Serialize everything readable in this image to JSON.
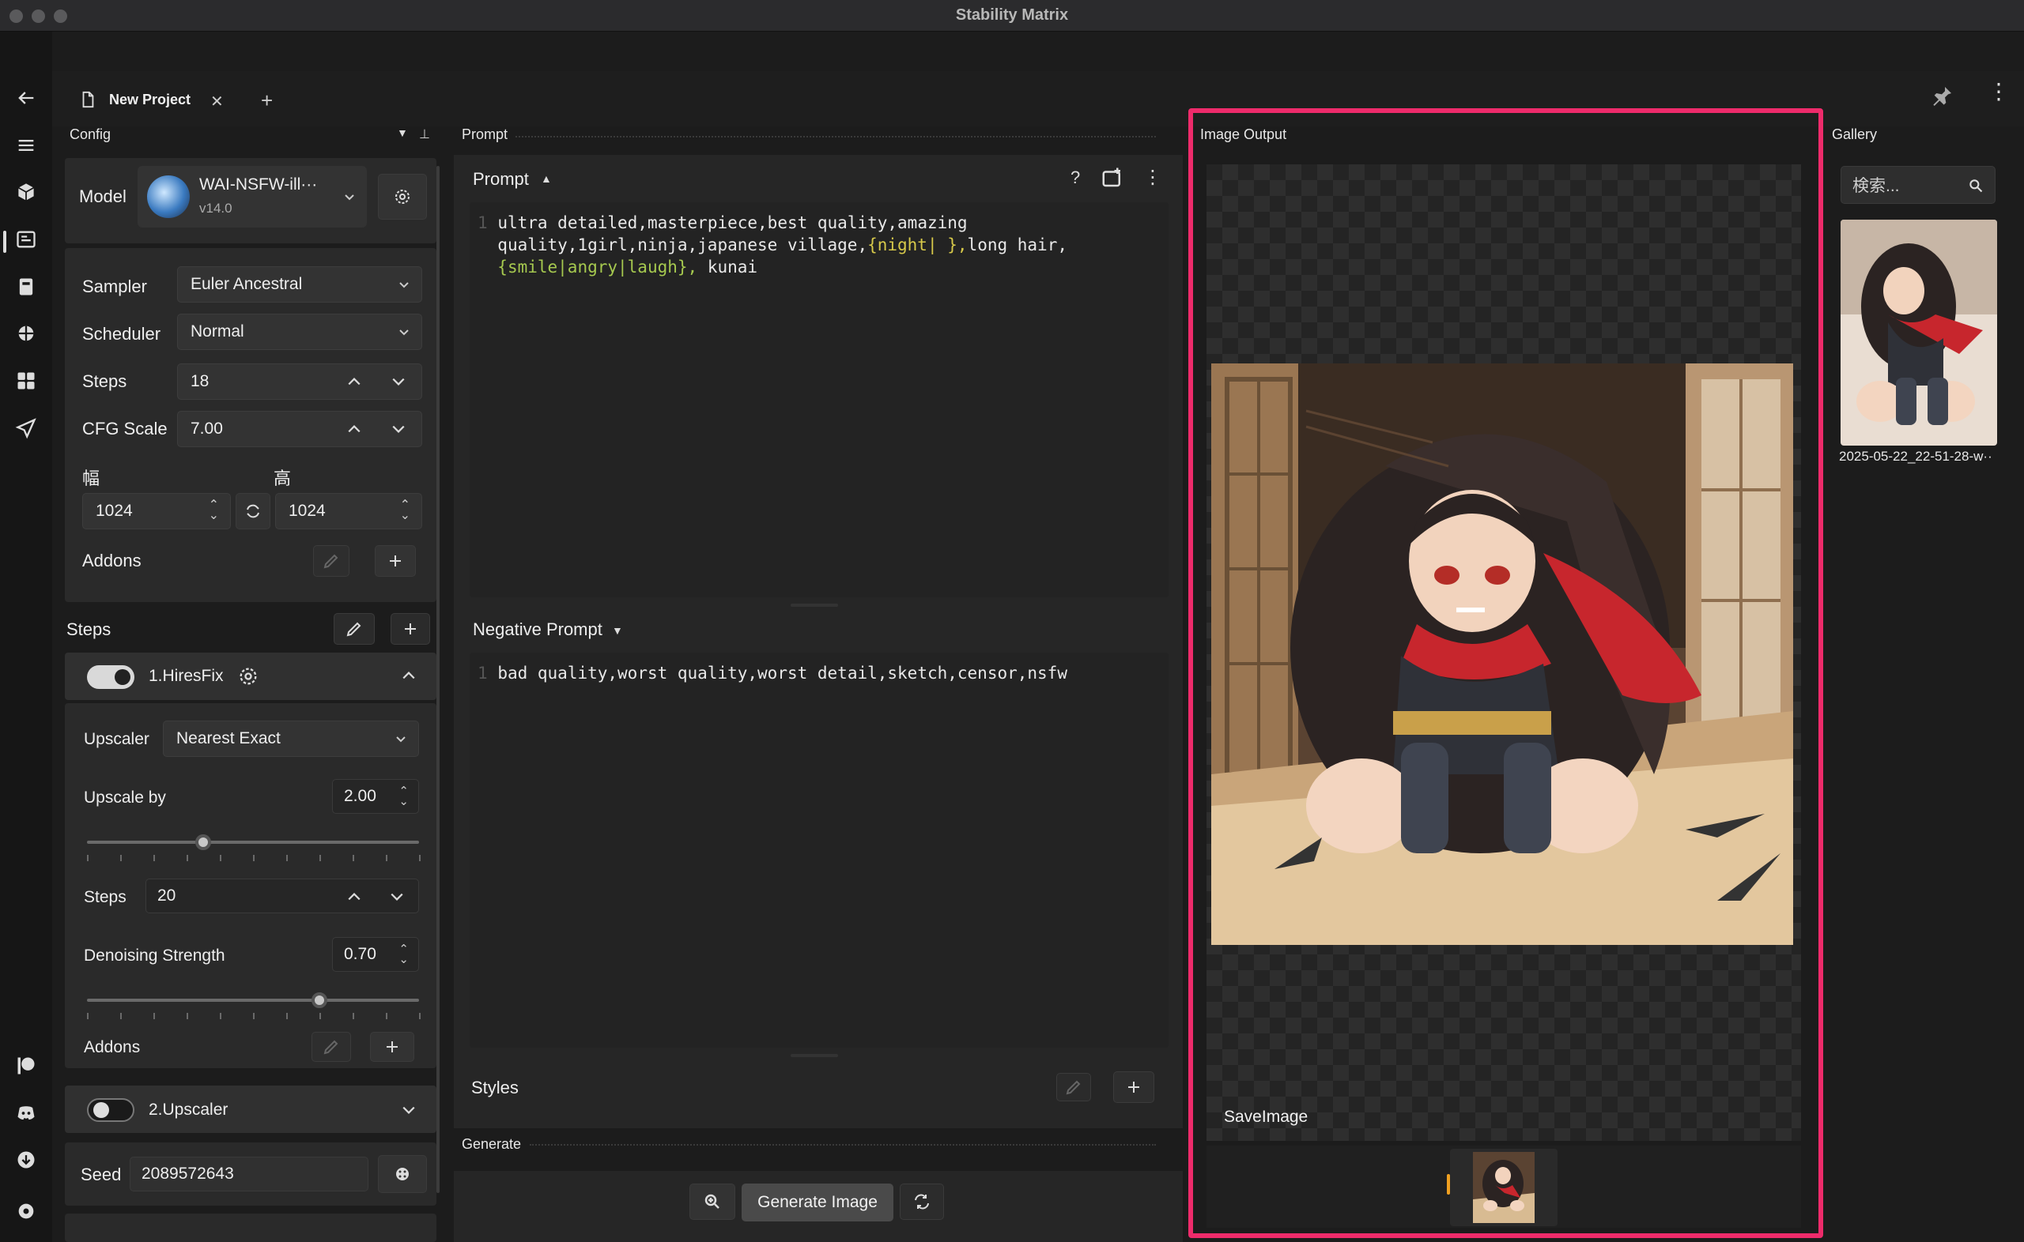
{
  "app": {
    "title": "Stability Matrix"
  },
  "tabs": [
    {
      "label": "New Project"
    }
  ],
  "panels": {
    "config": "Config",
    "prompt": "Prompt",
    "image_output": "Image Output",
    "gallery": "Gallery",
    "generate": "Generate"
  },
  "config": {
    "model_label": "Model",
    "model_name": "WAI-NSFW-ill···",
    "model_version": "v14.0",
    "sampler_label": "Sampler",
    "sampler_value": "Euler Ancestral",
    "scheduler_label": "Scheduler",
    "scheduler_value": "Normal",
    "steps_label": "Steps",
    "steps_value": "18",
    "cfg_label": "CFG Scale",
    "cfg_value": "7.00",
    "width_label": "幅",
    "height_label": "高",
    "width_value": "1024",
    "height_value": "1024",
    "addons_label": "Addons",
    "steps_section_label": "Steps",
    "hiresfix": {
      "label": "1.HiresFix",
      "enabled": true,
      "upscaler_label": "Upscaler",
      "upscaler_value": "Nearest Exact",
      "upscale_by_label": "Upscale by",
      "upscale_by_value": "2.00",
      "upscale_by_level": 0.35,
      "steps_label": "Steps",
      "steps_value": "20",
      "denoise_label": "Denoising Strength",
      "denoise_value": "0.70",
      "denoise_level": 0.7,
      "addons_label": "Addons"
    },
    "upscaler": {
      "label": "2.Upscaler",
      "enabled": false
    },
    "seed_label": "Seed",
    "seed_value": "2089572643"
  },
  "prompt": {
    "header": "Prompt",
    "help": "?",
    "line_number": "1",
    "text_line1": "ultra detailed,masterpiece,best quality,amazing",
    "text_line2a": "quality,1girl,ninja,japanese village,",
    "wild1": "{night|",
    "wild1b": " },",
    "text_line2b": "long hair,",
    "wild2": "{smile|angry|laugh},",
    "text_line3b": " kunai",
    "negative_header": "Negative Prompt",
    "negative_text": "bad quality,worst quality,worst detail,sketch,censor,nsfw",
    "styles_label": "Styles"
  },
  "generate": {
    "button": "Generate Image"
  },
  "image_output": {
    "node_label": "SaveImage"
  },
  "gallery": {
    "search_placeholder": "検索...",
    "items": [
      {
        "caption": "2025-05-22_22-51-28-w··"
      }
    ]
  },
  "colors": {
    "highlight": "#ee2b6b",
    "accent_orange": "#f0a020",
    "toggle_on": "#d9d9d9"
  },
  "icons": [
    "back-arrow-icon",
    "menu-icon",
    "package-icon",
    "inference-icon",
    "notebook-icon",
    "brain-icon",
    "grid-icon",
    "send-icon",
    "patreon-icon",
    "discord-icon",
    "download-icon",
    "settings-icon"
  ]
}
